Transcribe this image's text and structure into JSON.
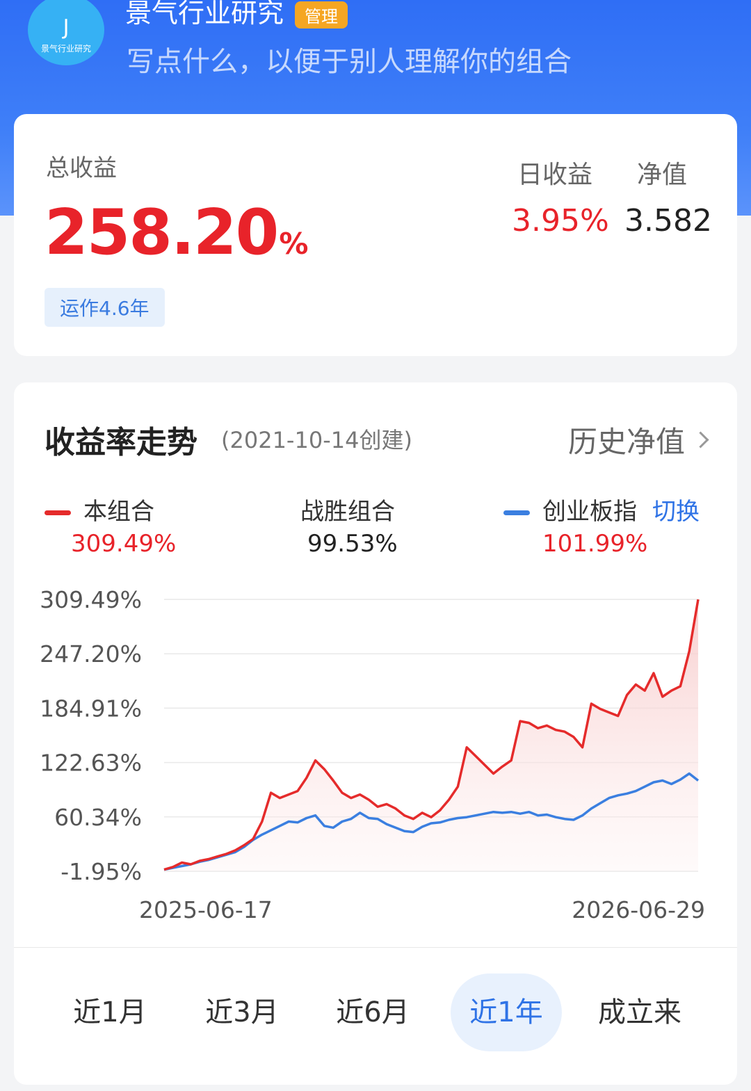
{
  "profile": {
    "avatar_letter": "J",
    "avatar_text": "景气行业研究",
    "name": "景气行业研究",
    "manage_label": "管理",
    "description": "写点什么，以便于别人理解你的组合"
  },
  "summary": {
    "total_label": "总收益",
    "total_value": "258.20",
    "total_unit": "%",
    "run_badge": "运作4.6年",
    "daily_label": "日收益",
    "daily_value": "3.95%",
    "nav_label": "净值",
    "nav_value": "3.582"
  },
  "chart_section": {
    "title": "收益率走势",
    "created": "(2021-10-14创建)",
    "history_link": "历史净值",
    "legend": {
      "portfolio_label": "本组合",
      "portfolio_value": "309.49%",
      "beat_label": "战胜组合",
      "beat_value": "99.53%",
      "index_label": "创业板指",
      "index_value": "101.99%",
      "switch_label": "切换"
    }
  },
  "colors": {
    "portfolio": "#e52b2b",
    "index": "#3b7fe0",
    "accent": "#2f73e6",
    "up": "#e8232a"
  },
  "chart_data": {
    "type": "line",
    "x_start_label": "2025-06-17",
    "x_end_label": "2026-06-29",
    "y_tick_labels": [
      "309.49%",
      "247.20%",
      "184.91%",
      "122.63%",
      "60.34%",
      "-1.95%"
    ],
    "ylim": [
      -1.95,
      309.49
    ],
    "x_count": 61,
    "series": [
      {
        "name": "本组合",
        "values": [
          0,
          3,
          8,
          6,
          10,
          12,
          15,
          18,
          22,
          28,
          35,
          55,
          88,
          82,
          86,
          90,
          105,
          125,
          115,
          102,
          88,
          82,
          86,
          80,
          72,
          75,
          70,
          62,
          58,
          65,
          60,
          68,
          80,
          95,
          140,
          130,
          120,
          110,
          118,
          125,
          170,
          168,
          162,
          165,
          160,
          158,
          152,
          140,
          190,
          184,
          180,
          176,
          200,
          212,
          205,
          225,
          198,
          205,
          210,
          250,
          309.49
        ]
      },
      {
        "name": "创业板指",
        "values": [
          0,
          2,
          4,
          6,
          9,
          11,
          14,
          17,
          20,
          26,
          34,
          40,
          45,
          50,
          55,
          54,
          59,
          62,
          50,
          48,
          55,
          58,
          65,
          59,
          58,
          52,
          48,
          44,
          43,
          49,
          53,
          54,
          57,
          59,
          60,
          62,
          64,
          66,
          65,
          66,
          64,
          66,
          62,
          63,
          60,
          58,
          57,
          62,
          70,
          76,
          82,
          85,
          87,
          90,
          95,
          100,
          102,
          98,
          103,
          110,
          101.99
        ]
      }
    ]
  },
  "range_tabs": {
    "items": [
      "近1月",
      "近3月",
      "近6月",
      "近1年",
      "成立来"
    ],
    "active_index": 3
  }
}
